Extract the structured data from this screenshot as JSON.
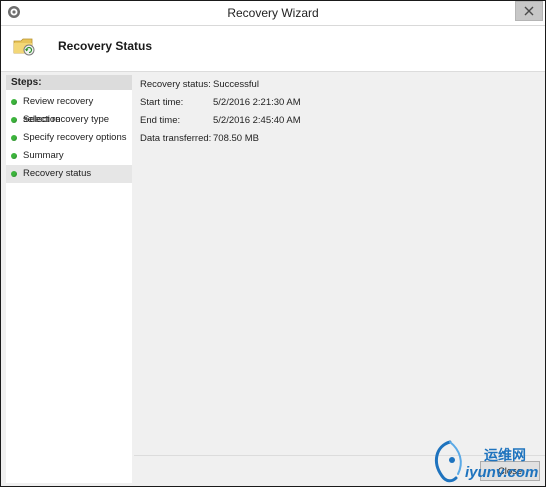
{
  "window": {
    "title": "Recovery Wizard",
    "close_icon": "close-icon",
    "system_icon": "backup-app-icon"
  },
  "header": {
    "title": "Recovery Status",
    "icon": "folder-recovery-icon"
  },
  "sidebar": {
    "heading": "Steps:",
    "items": [
      {
        "label": "Review recovery selection",
        "status_color": "#3cb43c"
      },
      {
        "label": "Select recovery type",
        "status_color": "#3cb43c"
      },
      {
        "label": "Specify recovery options",
        "status_color": "#3cb43c"
      },
      {
        "label": "Summary",
        "status_color": "#3cb43c"
      },
      {
        "label": "Recovery status",
        "status_color": "#3cb43c",
        "selected": true
      }
    ]
  },
  "status": {
    "rows": [
      {
        "label": "Recovery status:",
        "value": "Successful"
      },
      {
        "label": "Start time:",
        "value": "5/2/2016 2:21:30 AM"
      },
      {
        "label": "End time:",
        "value": "5/2/2016 2:45:40 AM"
      },
      {
        "label": "Data transferred:",
        "value": "708.50 MB"
      }
    ]
  },
  "footer": {
    "close_label": "Close"
  },
  "watermark": {
    "chinese": "运维网",
    "domain": "iyunv.com",
    "color": "#1e73be"
  }
}
